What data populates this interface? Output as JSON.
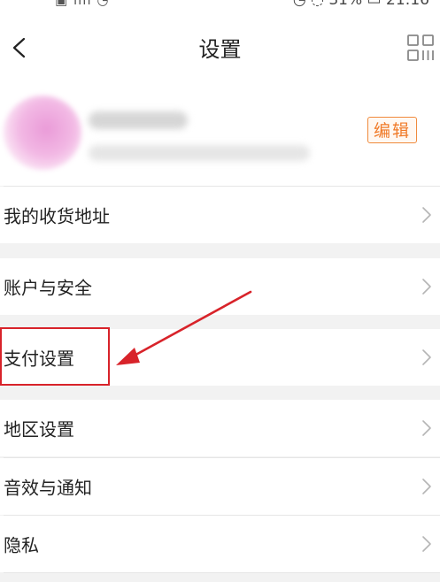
{
  "status_bar": {
    "left_icons": "▣ ıllı ◔",
    "right_text": "◷ ◌ 31% ▭ 21:16"
  },
  "header": {
    "title": "设置",
    "back_icon": "chevron-left-icon",
    "qr_icon": "qr-code-icon"
  },
  "profile": {
    "name": "",
    "subtitle": "",
    "edit_label": "编辑"
  },
  "settings": {
    "items": [
      {
        "label": "我的收货地址"
      },
      {
        "label": "账户与安全"
      },
      {
        "label": "支付设置",
        "highlighted": true
      },
      {
        "label": "地区设置"
      },
      {
        "label": "音效与通知"
      },
      {
        "label": "隐私"
      }
    ]
  },
  "annotation": {
    "color": "#d8232a",
    "target": "支付设置"
  },
  "colors": {
    "accent": "#f07a28",
    "background": "#f2f2f2",
    "annotation_red": "#d8232a"
  }
}
